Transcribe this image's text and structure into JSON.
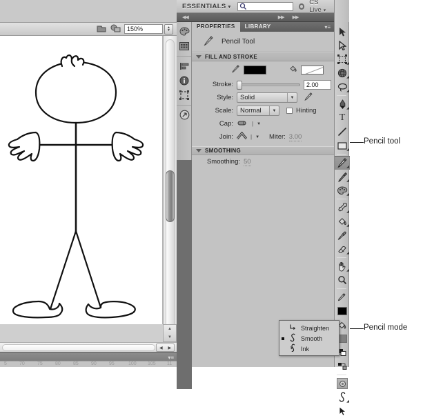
{
  "app": {
    "workspace_label": "ESSENTIALS",
    "workspace_caret": "▾",
    "search_placeholder": "",
    "search_icon": "search-icon",
    "cs_live_label": "CS Live",
    "cs_live_caret": "▾"
  },
  "document": {
    "zoom_value": "150%",
    "stepper_up": "▲",
    "stepper_down": "▼",
    "scroll_left": "◀",
    "scroll_right": "▶",
    "scroll_up": "▲",
    "scroll_down": "▼",
    "timeline_menu": "▾≡",
    "ruler_ticks": [
      "5",
      "70",
      "75",
      "80",
      "85",
      "90",
      "95",
      "100",
      "105",
      "11"
    ]
  },
  "dock": {
    "icons": [
      {
        "name": "color-panel-icon"
      },
      {
        "name": "swatches-panel-icon"
      },
      {
        "name": "align-panel-icon"
      },
      {
        "name": "info-panel-icon"
      },
      {
        "name": "transform-panel-icon"
      },
      {
        "name": "share-panel-icon"
      }
    ]
  },
  "panel": {
    "tabs": [
      {
        "label": "PROPERTIES",
        "active": true
      },
      {
        "label": "LIBRARY",
        "active": false
      }
    ],
    "menu_glyph": "▾≡",
    "tool_title": "Pencil Tool",
    "tool_icon": "pencil-icon",
    "sections": [
      {
        "title": "FILL AND STROKE",
        "rows": {
          "stroke_color_swatch": "#000000",
          "fill_color_swatch": "none",
          "stroke_label": "Stroke:",
          "stroke_value": "2.00",
          "style_label": "Style:",
          "style_value": "Solid",
          "scale_label": "Scale:",
          "scale_value": "Normal",
          "hinting_label": "Hinting",
          "hinting_checked": false,
          "cap_label": "Cap:",
          "join_label": "Join:",
          "miter_label": "Miter:",
          "miter_value": "3.00"
        }
      },
      {
        "title": "SMOOTHING",
        "rows": {
          "smoothing_label": "Smoothing:",
          "smoothing_value": "50"
        }
      }
    ]
  },
  "toolbar": {
    "tools": [
      {
        "name": "selection-tool",
        "glyph": "selection-arrow-icon",
        "selected": false
      },
      {
        "name": "subselection-tool",
        "glyph": "subselection-arrow-icon",
        "selected": false
      },
      {
        "name": "free-transform-tool",
        "glyph": "free-transform-icon",
        "selected": false
      },
      {
        "name": "lasso-3d-tool",
        "glyph": "three-d-rotation-icon",
        "selected": false
      },
      {
        "name": "lasso-tool",
        "glyph": "lasso-icon",
        "selected": false
      },
      {
        "name": "pen-tool",
        "glyph": "pen-icon",
        "selected": false
      },
      {
        "name": "text-tool",
        "glyph": "text-t-icon",
        "selected": false
      },
      {
        "name": "line-tool",
        "glyph": "line-icon",
        "selected": false
      },
      {
        "name": "rectangle-tool",
        "glyph": "rectangle-icon",
        "selected": false
      },
      {
        "name": "pencil-tool",
        "glyph": "pencil-icon",
        "selected": true
      },
      {
        "name": "brush-tool",
        "glyph": "brush-icon",
        "selected": false
      },
      {
        "name": "deco-tool",
        "glyph": "deco-icon",
        "selected": false
      },
      {
        "name": "bone-tool",
        "glyph": "bone-icon",
        "selected": false
      },
      {
        "name": "paint-bucket-tool",
        "glyph": "paint-bucket-icon",
        "selected": false
      },
      {
        "name": "eyedropper-tool",
        "glyph": "eyedropper-icon",
        "selected": false
      },
      {
        "name": "eraser-tool",
        "glyph": "eraser-icon",
        "selected": false
      },
      {
        "name": "hand-tool",
        "glyph": "hand-icon",
        "selected": false
      },
      {
        "name": "zoom-tool",
        "glyph": "magnifier-icon",
        "selected": false
      }
    ],
    "colors": {
      "stroke_color_tool": "#000000",
      "fill_color_tool": "#808080"
    },
    "options": [
      {
        "name": "snap-to-objects-option",
        "glyph": "magnet-icon"
      },
      {
        "name": "straighten-option",
        "glyph": "straighten-icon"
      },
      {
        "name": "smooth-option",
        "glyph": "smooth-icon"
      },
      {
        "name": "pencil-mode-option",
        "glyph": "pencil-mode-icon"
      }
    ]
  },
  "popup": {
    "items": [
      {
        "label": "Straighten",
        "glyph": "straighten-icon",
        "selected": false
      },
      {
        "label": "Smooth",
        "glyph": "smooth-curve-icon",
        "selected": true
      },
      {
        "label": "Ink",
        "glyph": "ink-icon",
        "selected": false
      }
    ]
  },
  "callouts": [
    {
      "text": "Pencil tool"
    },
    {
      "text": "Pencil mode"
    }
  ],
  "artwork": {
    "name": "stick-figure-drawing",
    "description": "hand-drawn stick figure with oval head, hair tuft, arms with hands, legs and shoes"
  }
}
